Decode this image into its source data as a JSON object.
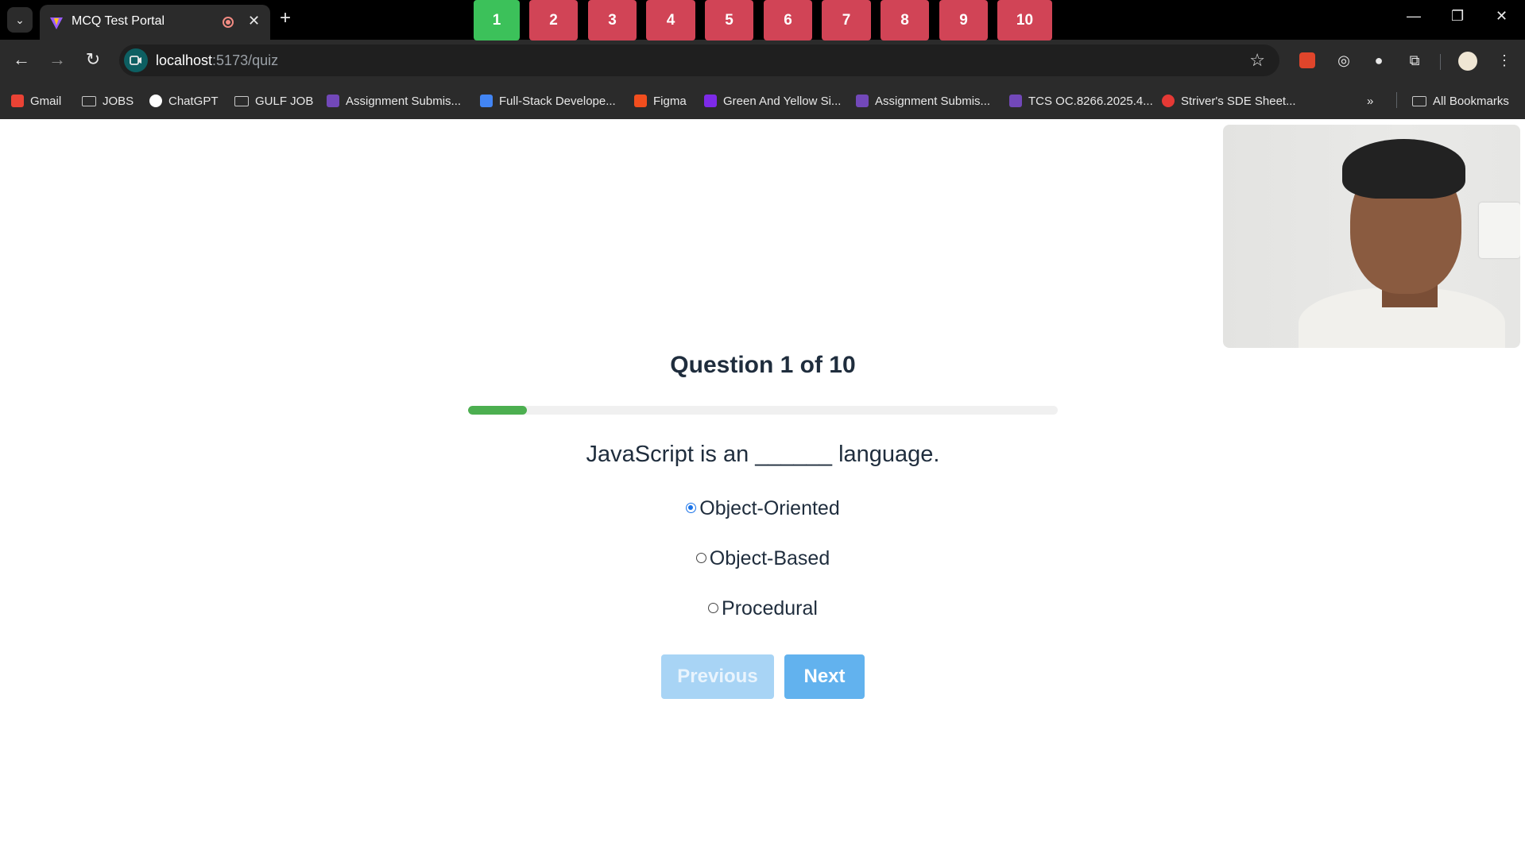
{
  "browser": {
    "tab_title": "MCQ Test Portal",
    "url_host": "localhost",
    "url_path": ":5173/quiz",
    "bookmarks": [
      {
        "label": "Gmail",
        "icon": "gmail-icon",
        "color": "#ea4335"
      },
      {
        "label": "JOBS",
        "icon": "folder-icon"
      },
      {
        "label": "ChatGPT",
        "icon": "chatgpt-icon",
        "color": "#ffffff"
      },
      {
        "label": "GULF JOB",
        "icon": "folder-icon"
      },
      {
        "label": "Assignment Submis...",
        "icon": "forms-icon",
        "color": "#7248b9"
      },
      {
        "label": "Full-Stack Develope...",
        "icon": "docs-icon",
        "color": "#4285f4"
      },
      {
        "label": "Figma",
        "icon": "figma-icon",
        "color": "#f24e1e"
      },
      {
        "label": "Green And Yellow Si...",
        "icon": "canva-icon",
        "color": "#7d2ae8"
      },
      {
        "label": "Assignment Submis...",
        "icon": "forms-icon",
        "color": "#7248b9"
      },
      {
        "label": "TCS OC.8266.2025.4...",
        "icon": "forms-icon",
        "color": "#7248b9"
      },
      {
        "label": "Striver's SDE Sheet...",
        "icon": "tuf-icon",
        "color": "#e53935"
      }
    ],
    "all_bookmarks_label": "All Bookmarks",
    "more_bookmarks": "»"
  },
  "quiz": {
    "question_buttons": [
      "1",
      "2",
      "3",
      "4",
      "5",
      "6",
      "7",
      "8",
      "9",
      "10"
    ],
    "active_question": 1,
    "title": "Question 1 of 10",
    "progress_fraction": 0.1,
    "question_text": "JavaScript is an ______ language.",
    "options": [
      "Object-Oriented",
      "Object-Based",
      "Procedural"
    ],
    "selected_option": 0,
    "prev_label": "Previous",
    "next_label": "Next",
    "colors": {
      "active": "#3cc15a",
      "inactive": "#d14456",
      "progress": "#4caf50"
    }
  }
}
